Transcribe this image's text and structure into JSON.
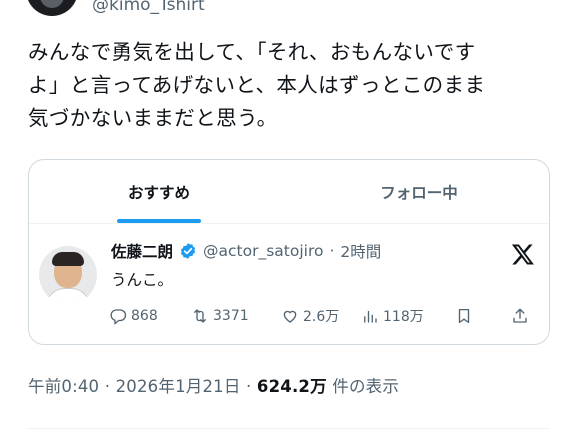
{
  "header": {
    "handle": "@kimo_Tshirt"
  },
  "tweet": {
    "text_line1": "みんなで勇気を出して、「それ、おもんないです",
    "text_line2": "よ」と言ってあげないと、本人はずっとこのまま",
    "text_line3": "気づかないままだと思う。"
  },
  "card": {
    "tabs": [
      {
        "label": "おすすめ",
        "active": true
      },
      {
        "label": "フォロー中",
        "active": false
      }
    ],
    "quoted": {
      "name": "佐藤二朗",
      "handle": "@actor_satojiro",
      "separator": "·",
      "time": "2時間",
      "text": "うんこ。",
      "replies": "868",
      "retweets": "3371",
      "likes": "2.6万",
      "views": "118万"
    }
  },
  "footer": {
    "time_date": "午前0:40 · 2026年1月21日 · ",
    "views_count": "624.2万",
    "views_suffix": " 件の表示"
  },
  "colors": {
    "accent": "#1d9bf0",
    "text": "#0f1419",
    "muted": "#536471",
    "border": "#cfd9de"
  }
}
